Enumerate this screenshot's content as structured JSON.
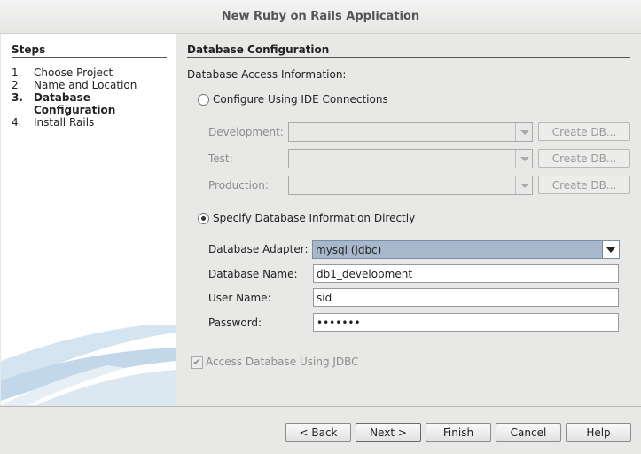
{
  "window": {
    "title": "New Ruby on Rails Application"
  },
  "steps": {
    "heading": "Steps",
    "items": [
      {
        "num": "1.",
        "label": "Choose Project"
      },
      {
        "num": "2.",
        "label": "Name and Location"
      },
      {
        "num": "3.",
        "label": "Database",
        "label2": "Configuration"
      },
      {
        "num": "4.",
        "label": "Install Rails"
      }
    ]
  },
  "panel": {
    "heading": "Database Configuration",
    "access_label": "Database Access Information:",
    "ide": {
      "radio_label": "Configure Using IDE Connections",
      "rows": [
        {
          "label": "Development:",
          "button": "Create DB..."
        },
        {
          "label": "Test:",
          "button": "Create DB..."
        },
        {
          "label": "Production:",
          "button": "Create DB..."
        }
      ]
    },
    "direct": {
      "radio_label": "Specify Database Information Directly",
      "adapter_label": "Database Adapter:",
      "adapter_value": "mysql (jdbc)",
      "name_label": "Database Name:",
      "name_value": "db1_development",
      "user_label": "User Name:",
      "user_value": "sid",
      "password_label": "Password:",
      "password_value": "•••••••"
    },
    "jdbc_label": "Access Database Using JDBC",
    "jdbc_check": "✔"
  },
  "buttons": {
    "back": "< Back",
    "next": "Next >",
    "finish": "Finish",
    "cancel": "Cancel",
    "help": "Help"
  }
}
